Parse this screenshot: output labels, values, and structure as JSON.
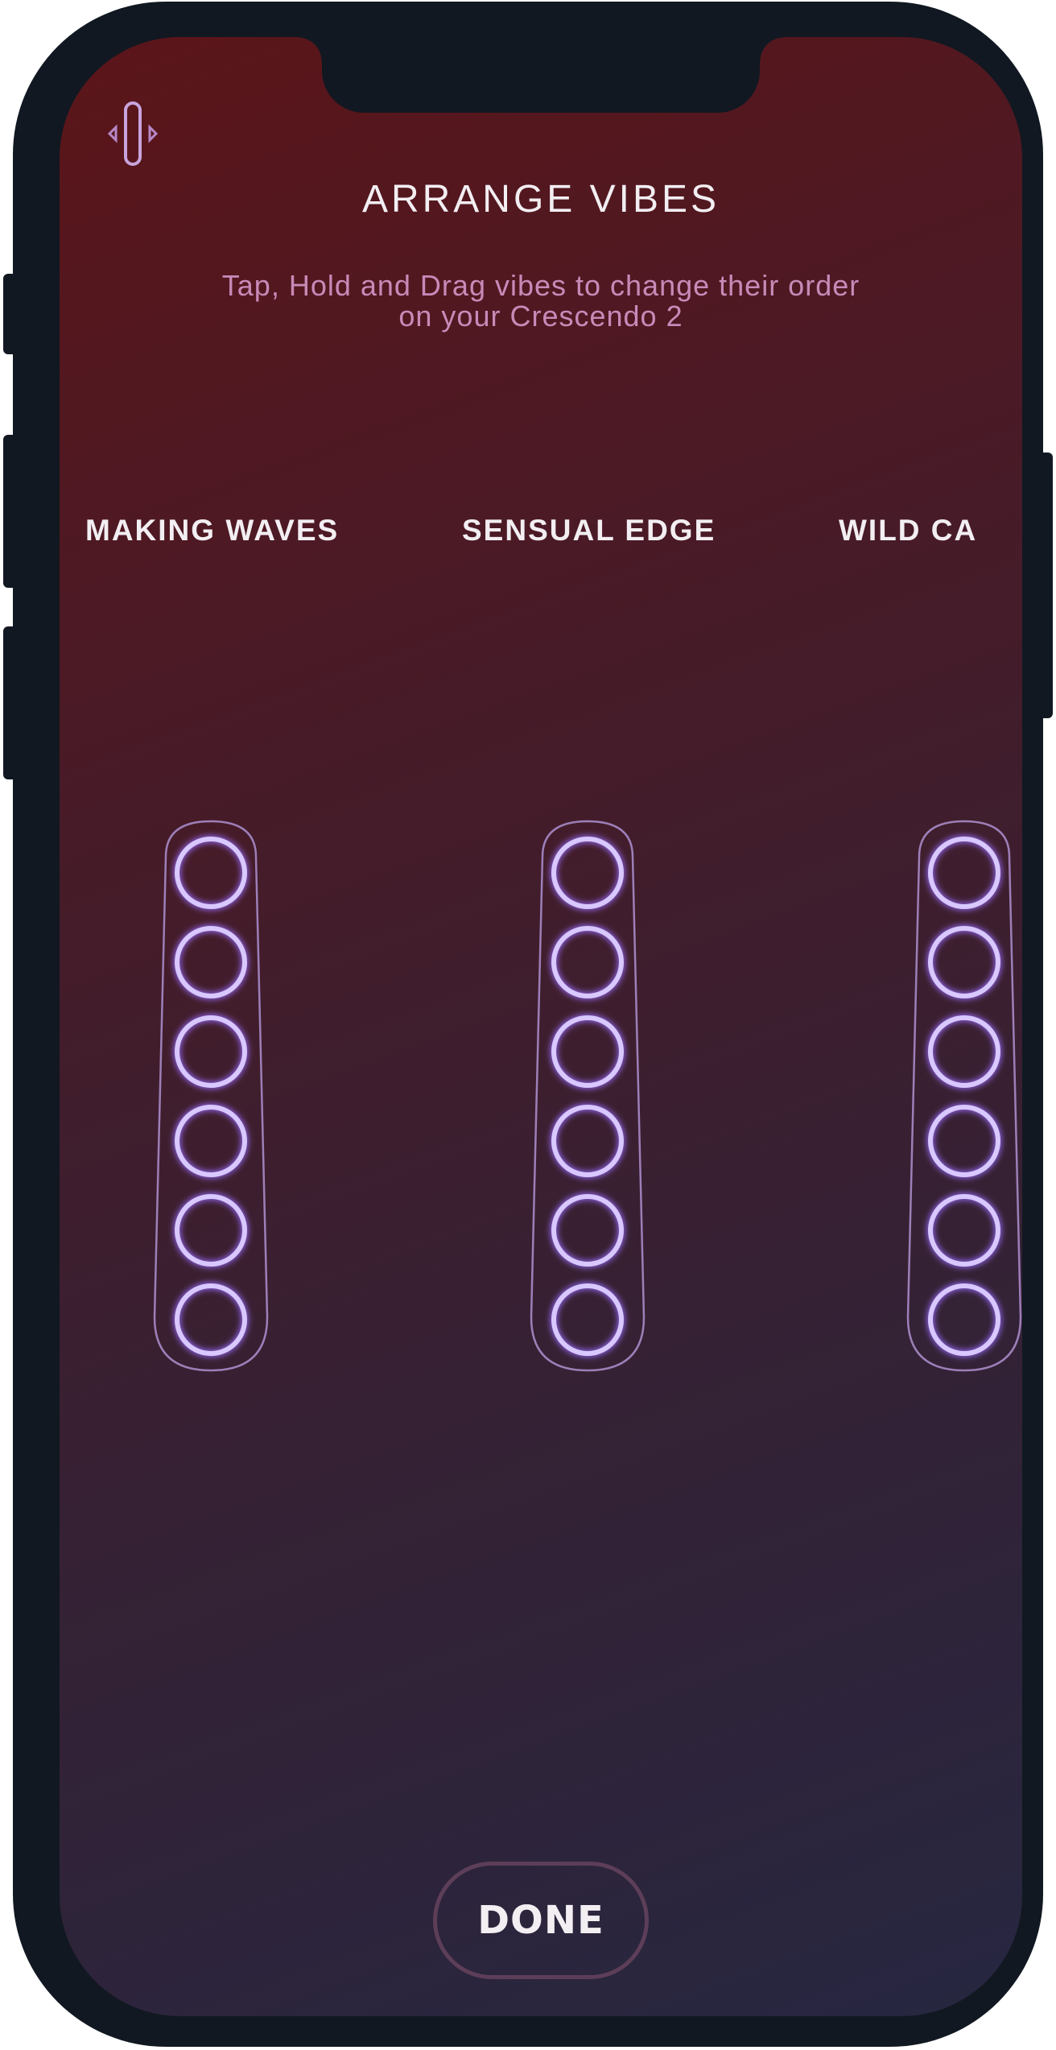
{
  "header": {
    "title": "ARRANGE VIBES",
    "subtitle": "Tap, Hold and Drag vibes to change their order on your Crescendo 2",
    "logo_icon": "crescendo-device-icon"
  },
  "vibes": [
    {
      "label": "MAKING WAVES",
      "ring_count": 6
    },
    {
      "label": "SENSUAL EDGE",
      "ring_count": 6
    },
    {
      "label": "WILD CA",
      "ring_count": 6
    }
  ],
  "footer": {
    "done_label": "DONE"
  },
  "colors": {
    "background_top": "#5b1519",
    "background_bottom": "#262741",
    "ring": "#d9c8ff",
    "ring_glow": "#9a6cff",
    "subtitle": "#c88ab8",
    "frame": "#111821"
  }
}
